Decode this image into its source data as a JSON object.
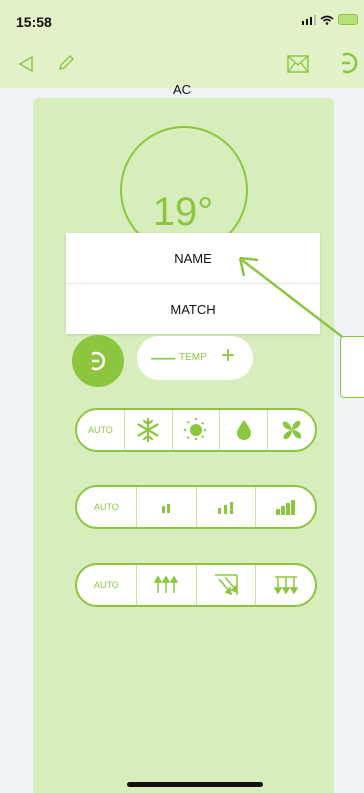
{
  "status": {
    "time": "15:58",
    "location_icon": "location-arrow-icon",
    "signal_icon": "signal-icon",
    "wifi_icon": "wifi-icon",
    "battery_icon": "battery-charging-icon"
  },
  "nav": {
    "back_icon": "back-icon",
    "edit_icon": "pencil-icon",
    "mail_icon": "mail-icon",
    "power_icon": "power-icon"
  },
  "device": {
    "title": "AC",
    "temperature": "19°"
  },
  "menu": {
    "items": [
      "NAME",
      "MATCH"
    ]
  },
  "controls": {
    "temp_label": "TEMP",
    "mode_row": {
      "auto": "AUTO",
      "icons": [
        "snowflake-icon",
        "sun-icon",
        "drop-icon",
        "fan-icon"
      ]
    },
    "speed_row": {
      "auto": "AUTO",
      "icons": [
        "fan-speed-low-icon",
        "fan-speed-medium-icon",
        "fan-speed-high-icon"
      ]
    },
    "swing_row": {
      "auto": "AUTO",
      "icons": [
        "swing-up-icon",
        "swing-diagonal-icon",
        "swing-down-icon"
      ]
    }
  },
  "colors": {
    "accent": "#8cc63f",
    "panel": "#d8edbc",
    "header": "#e2f1c8"
  }
}
